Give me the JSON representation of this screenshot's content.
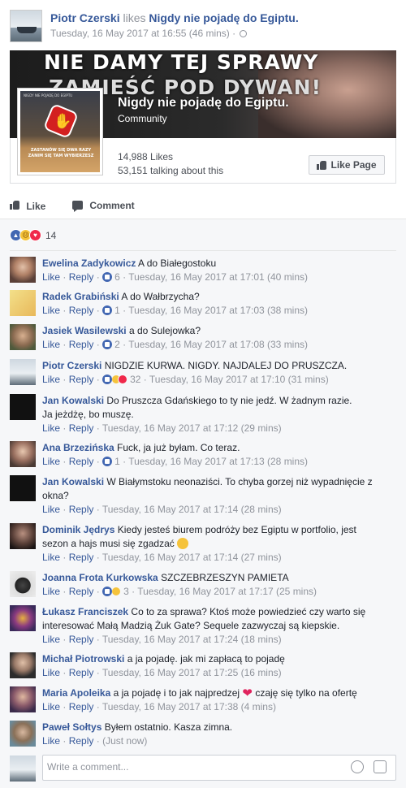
{
  "post": {
    "author": "Piotr Czerski",
    "action": "likes",
    "page": "Nigdy nie pojadę do Egiptu.",
    "timestamp": "Tuesday, 16 May 2017 at 16:55 (46 mins) ·"
  },
  "page_card": {
    "cover_line1": "NIE DAMY TEJ SPRAWY",
    "cover_line2": "ZAMIEŚĆ POD DYWAN!",
    "picture_header": "NIGDY NIE POJADĘ DO EGIPTU",
    "picture_caption1": "ZASTANÓW SIĘ DWA RAZY",
    "picture_caption2": "ZANIM SIĘ TAM WYBIERZESZ",
    "name": "Nigdy nie pojadę do Egiptu.",
    "category": "Community",
    "likes": "14,988 Likes",
    "talking": "53,151 talking about this",
    "like_button": "Like Page"
  },
  "actions": {
    "like": "Like",
    "comment": "Comment"
  },
  "reactions": {
    "count": "14"
  },
  "comments": [
    {
      "name": "Ewelina Zadykowicz",
      "text": "A do Białegostoku",
      "likes": "6",
      "time": "Tuesday, 16 May 2017 at 17:01 (40 mins)"
    },
    {
      "name": "Radek Grabiński",
      "text": "A do Wałbrzycha?",
      "likes": "1",
      "time": "Tuesday, 16 May 2017 at 17:03 (38 mins)"
    },
    {
      "name": "Jasiek Wasilewski",
      "text": "a do Sulejowka?",
      "likes": "2",
      "time": "Tuesday, 16 May 2017 at 17:08 (33 mins)"
    },
    {
      "name": "Piotr Czerski",
      "text": "NIGDZIE KURWA. NIGDY. NAJDALEJ DO PRUSZCZA.",
      "likes": "32",
      "time": "Tuesday, 16 May 2017 at 17:10 (31 mins)"
    },
    {
      "name": "Jan Kowalski",
      "text": "Do Pruszcza Gdańskiego to ty nie jedź. W żadnym razie.",
      "text2": "Ja jeżdżę, bo muszę.",
      "time": "Tuesday, 16 May 2017 at 17:12 (29 mins)"
    },
    {
      "name": "Ana Brzezińska",
      "text": "Fuck, ja już byłam. Co teraz.",
      "likes": "1",
      "time": "Tuesday, 16 May 2017 at 17:13 (28 mins)"
    },
    {
      "name": "Jan Kowalski",
      "text": "W Białymstoku neonaziści. To chyba gorzej niż wypadnięcie z",
      "text2": "okna?",
      "time": "Tuesday, 16 May 2017 at 17:14 (28 mins)"
    },
    {
      "name": "Dominik Jędrys",
      "text": "Kiedy jesteś biurem podróży bez Egiptu w portfolio, jest",
      "text2": "sezon a hajs musi się zgadzać",
      "time": "Tuesday, 16 May 2017 at 17:14 (27 mins)"
    },
    {
      "name": "Joanna Frota Kurkowska",
      "text": "SZCZEBRZESZYN PAMIETA",
      "likes": "3",
      "time": "Tuesday, 16 May 2017 at 17:17 (25 mins)"
    },
    {
      "name": "Łukasz Franciszek",
      "text": "Co to za sprawa? Ktoś może powiedzieć czy warto się",
      "text2": "interesować Małą Madzią Żuk Gate? Sequele zazwyczaj są kiepskie.",
      "time": "Tuesday, 16 May 2017 at 17:24 (18 mins)"
    },
    {
      "name": "Michał Piotrowski",
      "text": "a ja pojadę. jak mi zapłacą to pojadę",
      "time": "Tuesday, 16 May 2017 at 17:25 (16 mins)"
    },
    {
      "name": "Maria Apoleika",
      "text": "a ja pojadę i to jak najpredzej",
      "text_after": "czaję się tylko na ofertę",
      "time": "Tuesday, 16 May 2017 at 17:38 (4 mins)"
    },
    {
      "name": "Paweł Sołtys",
      "text": "Byłem ostatnio. Kasza zimna.",
      "time": "(Just now)"
    }
  ],
  "comment_meta": {
    "like": "Like",
    "reply": "Reply",
    "dot": "·"
  },
  "write": {
    "placeholder": "Write a comment..."
  },
  "colors": {
    "link": "#365899",
    "muted": "#90949c",
    "background": "#f6f7f9",
    "like_blue": "#4267b2",
    "love_red": "#f0284a"
  },
  "icons": [
    "globe-icon",
    "thumb-up-icon",
    "comment-icon",
    "like-reaction-icon",
    "sad-reaction-icon",
    "love-reaction-icon",
    "smiley-emoji",
    "heart-emoji",
    "emoji-picker-icon",
    "sticker-icon"
  ]
}
